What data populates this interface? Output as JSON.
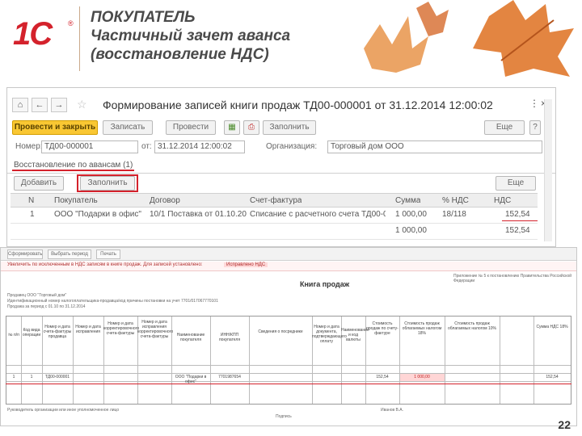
{
  "slide": {
    "title_line1": "ПОКУПАТЕЛЬ",
    "title_line2": "Частичный зачет аванса",
    "title_line3": "(восстановление НДС)",
    "logo_text": "1С",
    "logo_mark": "®",
    "page_number": "22"
  },
  "window": {
    "title": "Формирование записей книги продаж ТД00-000001 от 31.12.2014 12:00:02",
    "nav": {
      "home_icon": "home-icon",
      "back_icon": "arrow-left-icon",
      "forward_icon": "arrow-right-icon",
      "star_icon": "star-icon"
    },
    "ctrl_link": "⋮",
    "ctrl_close": "×",
    "toolbar": {
      "post_close": "Провести и закрыть",
      "save": "Записать",
      "post": "Провести",
      "fill": "Заполнить",
      "more": "Еще",
      "help": "?"
    },
    "fields": {
      "number_label": "Номер:",
      "number_value": "ТД00-000001",
      "date_label": "от:",
      "date_value": "31.12.2014 12:00:02",
      "org_label": "Организация:",
      "org_value": "Торговый дом ООО"
    },
    "tab_label": "Восстановление по авансам (1)",
    "sub_toolbar": {
      "add": "Добавить",
      "fill": "Заполнить",
      "more": "Еще"
    },
    "grid": {
      "headers": [
        "N",
        "Покупатель",
        "Договор",
        "Счет-фактура",
        "Сумма",
        "% НДС",
        "НДС"
      ],
      "rows": [
        [
          "1",
          "ООО \"Подарки в офис\"",
          "10/1 Поставка от 01.10.2014",
          "Списание с расчетного счета ТД00-000001",
          "1 000,00",
          "18/118",
          "152,54"
        ],
        [
          "",
          "",
          "",
          "",
          "1 000,00",
          "",
          "152,54"
        ]
      ]
    }
  },
  "report": {
    "toolbar": [
      "Сформировать",
      "Выбрать период",
      "Печать"
    ],
    "warning": "Увеличить по исключенным в НДС записям в книге продаж. Для записей установлено:",
    "warning_link": "Исправлено НДС",
    "title": "Книга продаж",
    "seller": "Продавец ООО \"Торговый дом\"",
    "inn_line": "Идентификационный номер налогоплательщика-продавца/код причины постановки на учет 7701/017067770101",
    "period": "Продажа за период с 01.10 по 31.12.2014",
    "note_right": "Приложение № 5 к постановлению Правительства Российской Федерации",
    "columns": [
      "№ п/п",
      "Код вида операции",
      "Номер и дата счета-фактуры продавца",
      "Номер и дата исправления",
      "Номер и дата корректировочного счета-фактуры",
      "Номер и дата исправления корректировочного счета-фактуры",
      "Наименование покупателя",
      "ИНН/КПП покупателя",
      "Сведения о посреднике",
      "Номер и дата документа, подтверждающего оплату",
      "Наименование и код валюты",
      "Стоимость продаж по счету-фактуре",
      "Стоимость продаж облагаемых налогом 18%",
      "Стоимость продаж облагаемых налогом 10%",
      "Сумма НДС 18%"
    ],
    "row_values": [
      "1",
      "1",
      "ТД00-000001",
      "",
      "",
      "",
      "ООО \"Подарки в офис\"",
      "7701987654",
      "",
      "",
      "",
      "152,54",
      "1 000,00",
      "",
      "152,54"
    ],
    "footer_left": "Руководитель организации или иное уполномоченное лицо",
    "footer_sign": "Подпись",
    "footer_name": "Иванов В.А."
  }
}
